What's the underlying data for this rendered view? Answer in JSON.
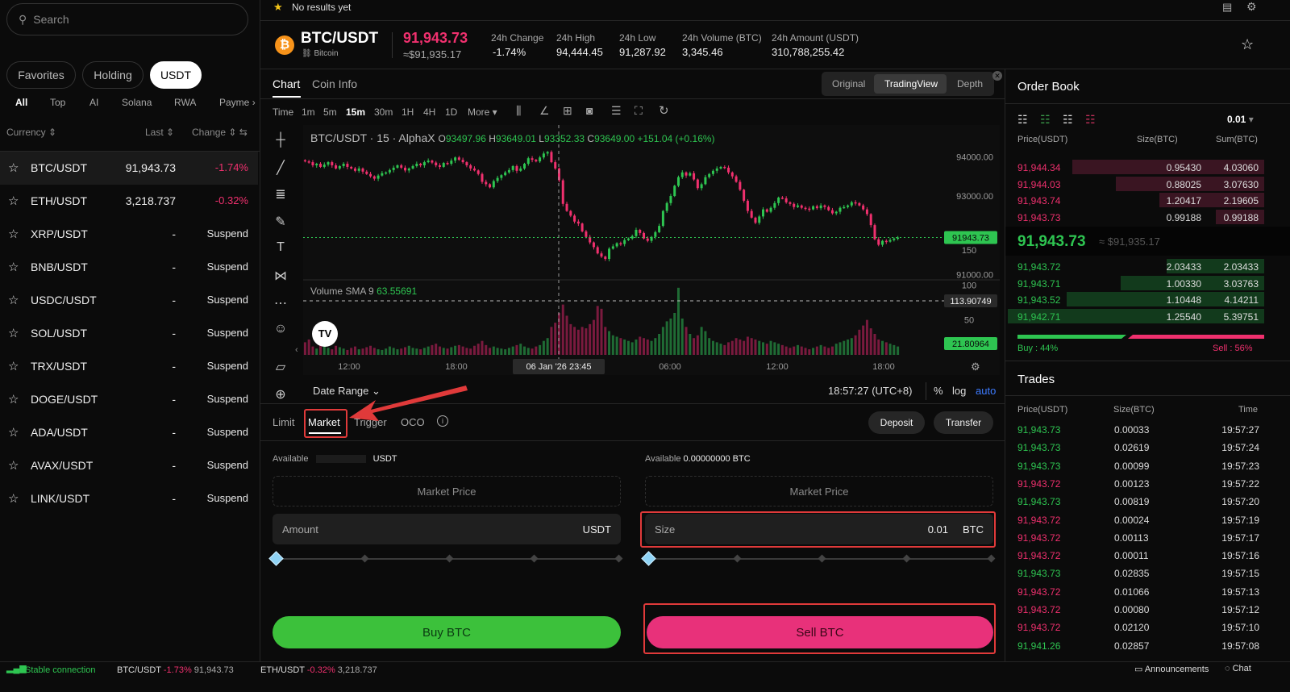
{
  "search": {
    "placeholder": "Search"
  },
  "market_tabs": [
    "Favorites",
    "Holding",
    "USDT"
  ],
  "sub_tabs": [
    "All",
    "Top",
    "AI",
    "Solana",
    "RWA",
    "Payme"
  ],
  "market_headers": {
    "currency": "Currency",
    "last": "Last",
    "change": "Change"
  },
  "markets": [
    {
      "symbol": "BTC/USDT",
      "last": "91,943.73",
      "change": "-1.74%"
    },
    {
      "symbol": "ETH/USDT",
      "last": "3,218.737",
      "change": "-0.32%"
    },
    {
      "symbol": "XRP/USDT",
      "last": "-",
      "change": "Suspend"
    },
    {
      "symbol": "BNB/USDT",
      "last": "-",
      "change": "Suspend"
    },
    {
      "symbol": "USDC/USDT",
      "last": "-",
      "change": "Suspend"
    },
    {
      "symbol": "SOL/USDT",
      "last": "-",
      "change": "Suspend"
    },
    {
      "symbol": "TRX/USDT",
      "last": "-",
      "change": "Suspend"
    },
    {
      "symbol": "DOGE/USDT",
      "last": "-",
      "change": "Suspend"
    },
    {
      "symbol": "ADA/USDT",
      "last": "-",
      "change": "Suspend"
    },
    {
      "symbol": "AVAX/USDT",
      "last": "-",
      "change": "Suspend"
    },
    {
      "symbol": "LINK/USDT",
      "last": "-",
      "change": "Suspend"
    }
  ],
  "topbar": {
    "favorites_note": "No results yet"
  },
  "ticker": {
    "pair": "BTC/USDT",
    "name": "Bitcoin",
    "price": "91,943.73",
    "price_usd": "≈$91,935.17",
    "stats": [
      {
        "label": "24h Change",
        "value": "-1.74%"
      },
      {
        "label": "24h High",
        "value": "94,444.45"
      },
      {
        "label": "24h Low",
        "value": "91,287.92"
      },
      {
        "label": "24h Volume (BTC)",
        "value": "3,345.46"
      },
      {
        "label": "24h Amount (USDT)",
        "value": "310,788,255.42"
      }
    ]
  },
  "chart_tabs": [
    "Chart",
    "Coin Info"
  ],
  "view_tabs": [
    "Original",
    "TradingView",
    "Depth"
  ],
  "intervals": [
    "Time",
    "1m",
    "5m",
    "15m",
    "30m",
    "1H",
    "4H",
    "1D",
    "More"
  ],
  "chart_legend": {
    "pair": "BTC/USDT · 15 · AlphaX",
    "o_label": "O",
    "o": "93497.96",
    "h_label": "H",
    "h": "93649.01",
    "l_label": "L",
    "l": "93352.33",
    "c_label": "C",
    "c": "93649.00",
    "chg": "+151.04 (+0.16%)"
  },
  "volume_legend": {
    "label": "Volume SMA 9",
    "value": "63.55691"
  },
  "chart_data": {
    "type": "candlestick",
    "price_ticks": [
      "94000.00",
      "93000.00",
      "91000.00"
    ],
    "price_marker": "91943.73",
    "volume_ticks": [
      "150",
      "100",
      "50"
    ],
    "volume_marker_sma": "113.90749",
    "volume_marker_last": "21.80964",
    "x_ticks": [
      "12:00",
      "18:00",
      "06:00",
      "12:00",
      "18:00"
    ],
    "crosshair_label": "06 Jan '26   23:45",
    "ylim": [
      90950,
      94600
    ],
    "closes": [
      93880,
      93860,
      93780,
      93820,
      93740,
      93800,
      93860,
      93780,
      93700,
      93760,
      93820,
      93740,
      93700,
      93640,
      93700,
      93620,
      93560,
      93500,
      93440,
      93520,
      93580,
      93600,
      93660,
      93720,
      93780,
      93720,
      93650,
      93700,
      93760,
      93820,
      93780,
      93860,
      93900,
      93850,
      93780,
      93740,
      93840,
      93820,
      93900,
      93980,
      93920,
      93860,
      93780,
      93700,
      93650,
      93560,
      93360,
      93300,
      93220,
      93380,
      93460,
      93530,
      93600,
      93660,
      93760,
      93640,
      93700,
      93820,
      93960,
      93920,
      93880,
      93980,
      94080,
      94120,
      93860,
      93700,
      93400,
      92800,
      92620,
      92500,
      92350,
      92300,
      92100,
      91960,
      91820,
      91700,
      91540,
      91460,
      91400,
      91660,
      91720,
      91800,
      91780,
      91880,
      91920,
      91980,
      92140,
      92060,
      91920,
      91860,
      91960,
      92080,
      92240,
      92620,
      92820,
      93000,
      93260,
      93480,
      93600,
      93520,
      93580,
      93420,
      93200,
      93300,
      93480,
      93560,
      93640,
      93700,
      93740,
      93720,
      93600,
      93500,
      93360,
      93160,
      92880,
      92620,
      92450,
      92320,
      92480,
      92660,
      92600,
      92700,
      92820,
      92960,
      92940,
      92840,
      92800,
      92720,
      92760,
      92700,
      92680,
      92660,
      92740,
      92690,
      92760,
      92720,
      92640,
      92560,
      92600,
      92700,
      92720,
      92760,
      92840,
      92820,
      92760,
      92660,
      92540,
      92260,
      91900,
      91760,
      91860,
      91840,
      91880,
      91920,
      91943
    ],
    "volumes": [
      18,
      22,
      12,
      9,
      14,
      16,
      10,
      8,
      13,
      11,
      9,
      7,
      10,
      12,
      8,
      9,
      11,
      13,
      10,
      8,
      7,
      9,
      12,
      10,
      8,
      9,
      11,
      13,
      10,
      9,
      8,
      10,
      12,
      14,
      16,
      12,
      10,
      9,
      11,
      13,
      14,
      12,
      10,
      9,
      13,
      16,
      20,
      14,
      10,
      12,
      10,
      9,
      8,
      10,
      12,
      14,
      16,
      12,
      10,
      9,
      12,
      14,
      20,
      24,
      40,
      46,
      60,
      72,
      56,
      44,
      40,
      36,
      40,
      38,
      44,
      50,
      70,
      66,
      40,
      34,
      28,
      26,
      24,
      22,
      20,
      18,
      22,
      26,
      24,
      22,
      20,
      24,
      30,
      40,
      48,
      52,
      60,
      96,
      52,
      40,
      30,
      24,
      28,
      40,
      34,
      24,
      20,
      18,
      16,
      14,
      18,
      20,
      24,
      22,
      20,
      26,
      24,
      22,
      20,
      18,
      16,
      20,
      18,
      16,
      14,
      12,
      10,
      12,
      14,
      12,
      10,
      8,
      10,
      12,
      14,
      12,
      10,
      12,
      16,
      18,
      20,
      22,
      24,
      28,
      36,
      42,
      50,
      38,
      30,
      22,
      20,
      18,
      16,
      14,
      12
    ]
  },
  "date_range": "Date Range",
  "clock": "18:57:27 (UTC+8)",
  "scale_opts": [
    "%",
    "log",
    "auto"
  ],
  "order_types": [
    "Limit",
    "Market",
    "Trigger",
    "OCO"
  ],
  "actions": {
    "deposit": "Deposit",
    "transfer": "Transfer"
  },
  "buy": {
    "available_label": "Available",
    "available_value": "USDT",
    "market_price": "Market Price",
    "amount_label": "Amount",
    "amount_unit": "USDT",
    "button": "Buy BTC"
  },
  "sell": {
    "available_label": "Available",
    "available_value": "0.00000000 BTC",
    "market_price": "Market Price",
    "size_label": "Size",
    "size_value": "0.01",
    "size_unit": "BTC",
    "button": "Sell BTC"
  },
  "orderbook": {
    "title": "Order Book",
    "precision": "0.01",
    "headers": {
      "price": "Price(USDT)",
      "size": "Size(BTC)",
      "sum": "Sum(BTC)"
    },
    "asks": [
      {
        "price": "91,944.34",
        "size": "0.95430",
        "sum": "4.03060",
        "depth": 0.75
      },
      {
        "price": "91,944.03",
        "size": "0.88025",
        "sum": "3.07630",
        "depth": 0.58
      },
      {
        "price": "91,943.74",
        "size": "1.20417",
        "sum": "2.19605",
        "depth": 0.41
      },
      {
        "price": "91,943.73",
        "size": "0.99188",
        "sum": "0.99188",
        "depth": 0.19
      }
    ],
    "mid_price": "91,943.73",
    "mid_usd": "≈ $91,935.17",
    "bids": [
      {
        "price": "91,943.72",
        "size": "2.03433",
        "sum": "2.03433",
        "depth": 0.38
      },
      {
        "price": "91,943.71",
        "size": "1.00330",
        "sum": "3.03763",
        "depth": 0.56
      },
      {
        "price": "91,943.52",
        "size": "1.10448",
        "sum": "4.14211",
        "depth": 0.77
      },
      {
        "price": "91,942.71",
        "size": "1.25540",
        "sum": "5.39751",
        "depth": 1.0
      }
    ],
    "buy_ratio": "Buy : 44%",
    "sell_ratio": "Sell : 56%",
    "buy_fraction": 0.44
  },
  "trades": {
    "title": "Trades",
    "headers": {
      "price": "Price(USDT)",
      "size": "Size(BTC)",
      "time": "Time"
    },
    "rows": [
      {
        "price": "91,943.73",
        "size": "0.00033",
        "time": "19:57:27",
        "side": "buy"
      },
      {
        "price": "91,943.73",
        "size": "0.02619",
        "time": "19:57:24",
        "side": "buy"
      },
      {
        "price": "91,943.73",
        "size": "0.00099",
        "time": "19:57:23",
        "side": "buy"
      },
      {
        "price": "91,943.72",
        "size": "0.00123",
        "time": "19:57:22",
        "side": "sell"
      },
      {
        "price": "91,943.73",
        "size": "0.00819",
        "time": "19:57:20",
        "side": "buy"
      },
      {
        "price": "91,943.72",
        "size": "0.00024",
        "time": "19:57:19",
        "side": "sell"
      },
      {
        "price": "91,943.72",
        "size": "0.00113",
        "time": "19:57:17",
        "side": "sell"
      },
      {
        "price": "91,943.72",
        "size": "0.00011",
        "time": "19:57:16",
        "side": "sell"
      },
      {
        "price": "91,943.73",
        "size": "0.02835",
        "time": "19:57:15",
        "side": "buy"
      },
      {
        "price": "91,943.72",
        "size": "0.01066",
        "time": "19:57:13",
        "side": "sell"
      },
      {
        "price": "91,943.72",
        "size": "0.00080",
        "time": "19:57:12",
        "side": "sell"
      },
      {
        "price": "91,943.72",
        "size": "0.02120",
        "time": "19:57:10",
        "side": "sell"
      },
      {
        "price": "91,941.26",
        "size": "0.02857",
        "time": "19:57:08",
        "side": "buy"
      }
    ]
  },
  "statusbar": {
    "connection": "Stable connection",
    "t1_pair": "BTC/USDT",
    "t1_chg": "-1.73%",
    "t1_price": "91,943.73",
    "t2_pair": "ETH/USDT",
    "t2_chg": "-0.32%",
    "t2_price": "3,218.737",
    "announcements": "Announcements",
    "chat": "Chat"
  },
  "colors": {
    "up": "#2ec551",
    "down": "#f0306e",
    "buy_button": "#3cc13b",
    "sell_button": "#e8317a"
  }
}
